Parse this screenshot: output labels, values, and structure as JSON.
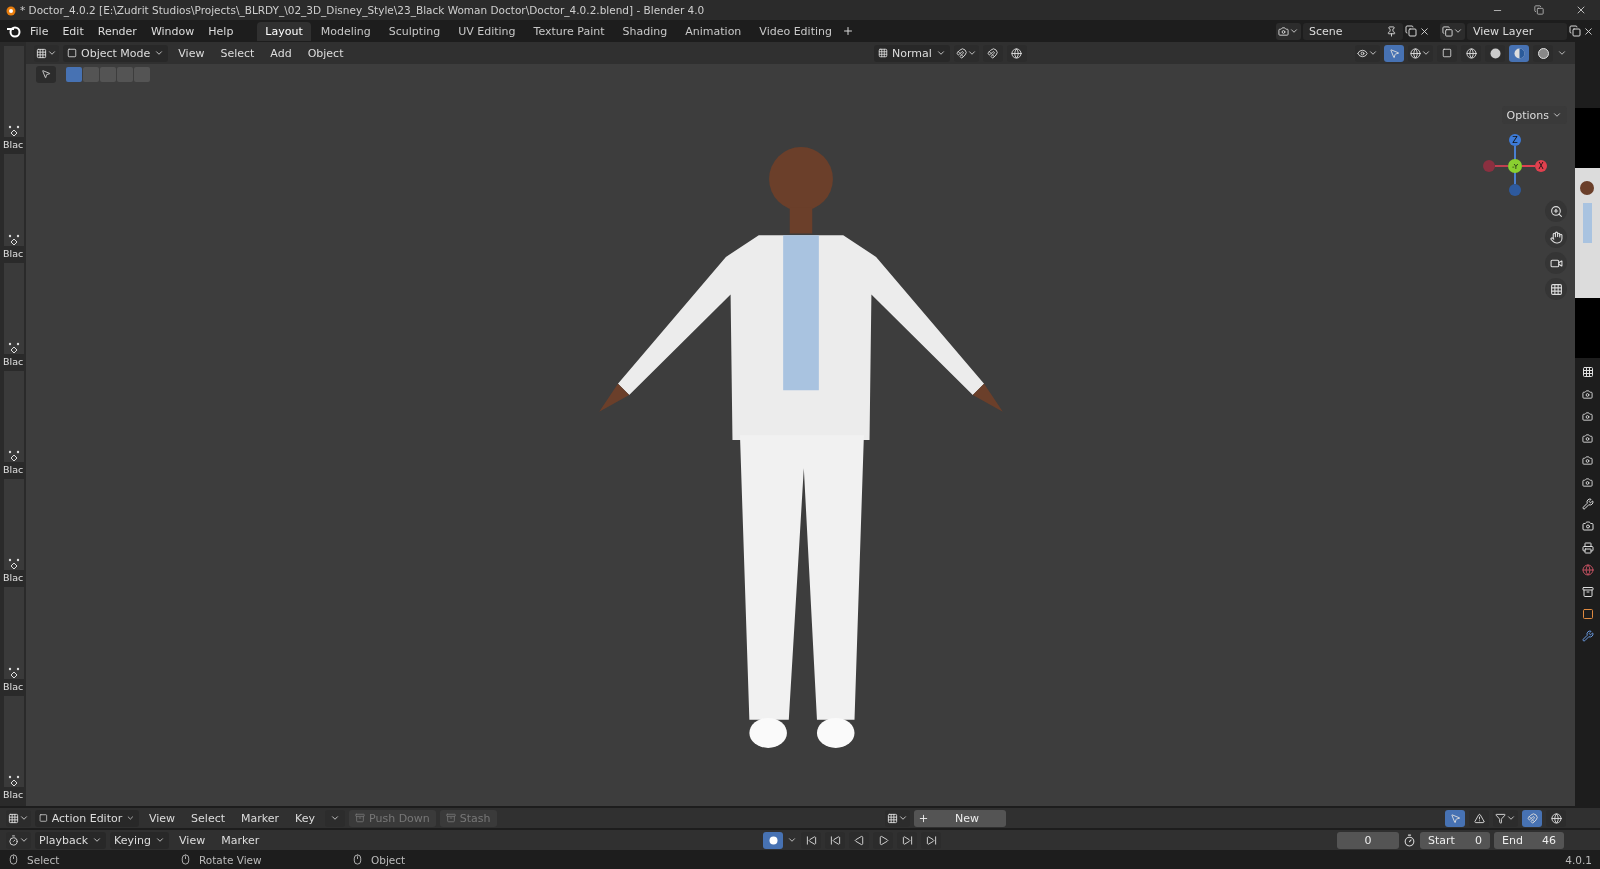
{
  "title_bar": {
    "title": "* Doctor_4.0.2 [E:\\Zudrit Studios\\Projects\\_BLRDY_\\02_3D_Disney_Style\\23_Black Woman Doctor\\Doctor_4.0.2.blend] - Blender 4.0"
  },
  "menu": [
    "File",
    "Edit",
    "Render",
    "Window",
    "Help"
  ],
  "workspaces": [
    {
      "label": "Layout",
      "selected": true
    },
    {
      "label": "Modeling",
      "selected": false
    },
    {
      "label": "Sculpting",
      "selected": false
    },
    {
      "label": "UV Editing",
      "selected": false
    },
    {
      "label": "Texture Paint",
      "selected": false
    },
    {
      "label": "Shading",
      "selected": false
    },
    {
      "label": "Animation",
      "selected": false
    },
    {
      "label": "Video Editing",
      "selected": false
    }
  ],
  "scene": {
    "name": "Scene"
  },
  "view_layer": {
    "name": "View Layer"
  },
  "viewport_header": {
    "mode": "Object Mode",
    "menus": [
      "View",
      "Select",
      "Add",
      "Object"
    ],
    "orientation": "Normal",
    "options": "Options"
  },
  "select_modes": [
    {
      "selected": true
    },
    {
      "selected": false
    },
    {
      "selected": false
    },
    {
      "selected": false
    },
    {
      "selected": false
    }
  ],
  "shading_modes": [
    {
      "kind": "wireframe",
      "selected": false
    },
    {
      "kind": "solid",
      "selected": false
    },
    {
      "kind": "material",
      "selected": true
    },
    {
      "kind": "rendered",
      "selected": false
    }
  ],
  "gizmo": {
    "z": "Z",
    "y": "-Y",
    "x": "X"
  },
  "action_strips": [
    {
      "label": "Blac"
    },
    {
      "label": "Blac"
    },
    {
      "label": "Blac"
    },
    {
      "label": "Blac"
    },
    {
      "label": "Blac"
    },
    {
      "label": "Blac"
    },
    {
      "label": "Blac"
    }
  ],
  "action_editor": {
    "mode": "Action Editor",
    "menus": [
      "View",
      "Select",
      "Marker",
      "Key"
    ],
    "push_down": "Push Down",
    "stash": "Stash",
    "new": "New"
  },
  "timeline": {
    "menus": [
      "Playback",
      "Keying",
      "View",
      "Marker"
    ],
    "auto_key": true,
    "current_frame": "0",
    "start_label": "Start",
    "start": "0",
    "end_label": "End",
    "end": "46"
  },
  "status_bar": {
    "hints": [
      "Select",
      "Rotate View",
      "Object"
    ],
    "version": "4.0.1"
  }
}
